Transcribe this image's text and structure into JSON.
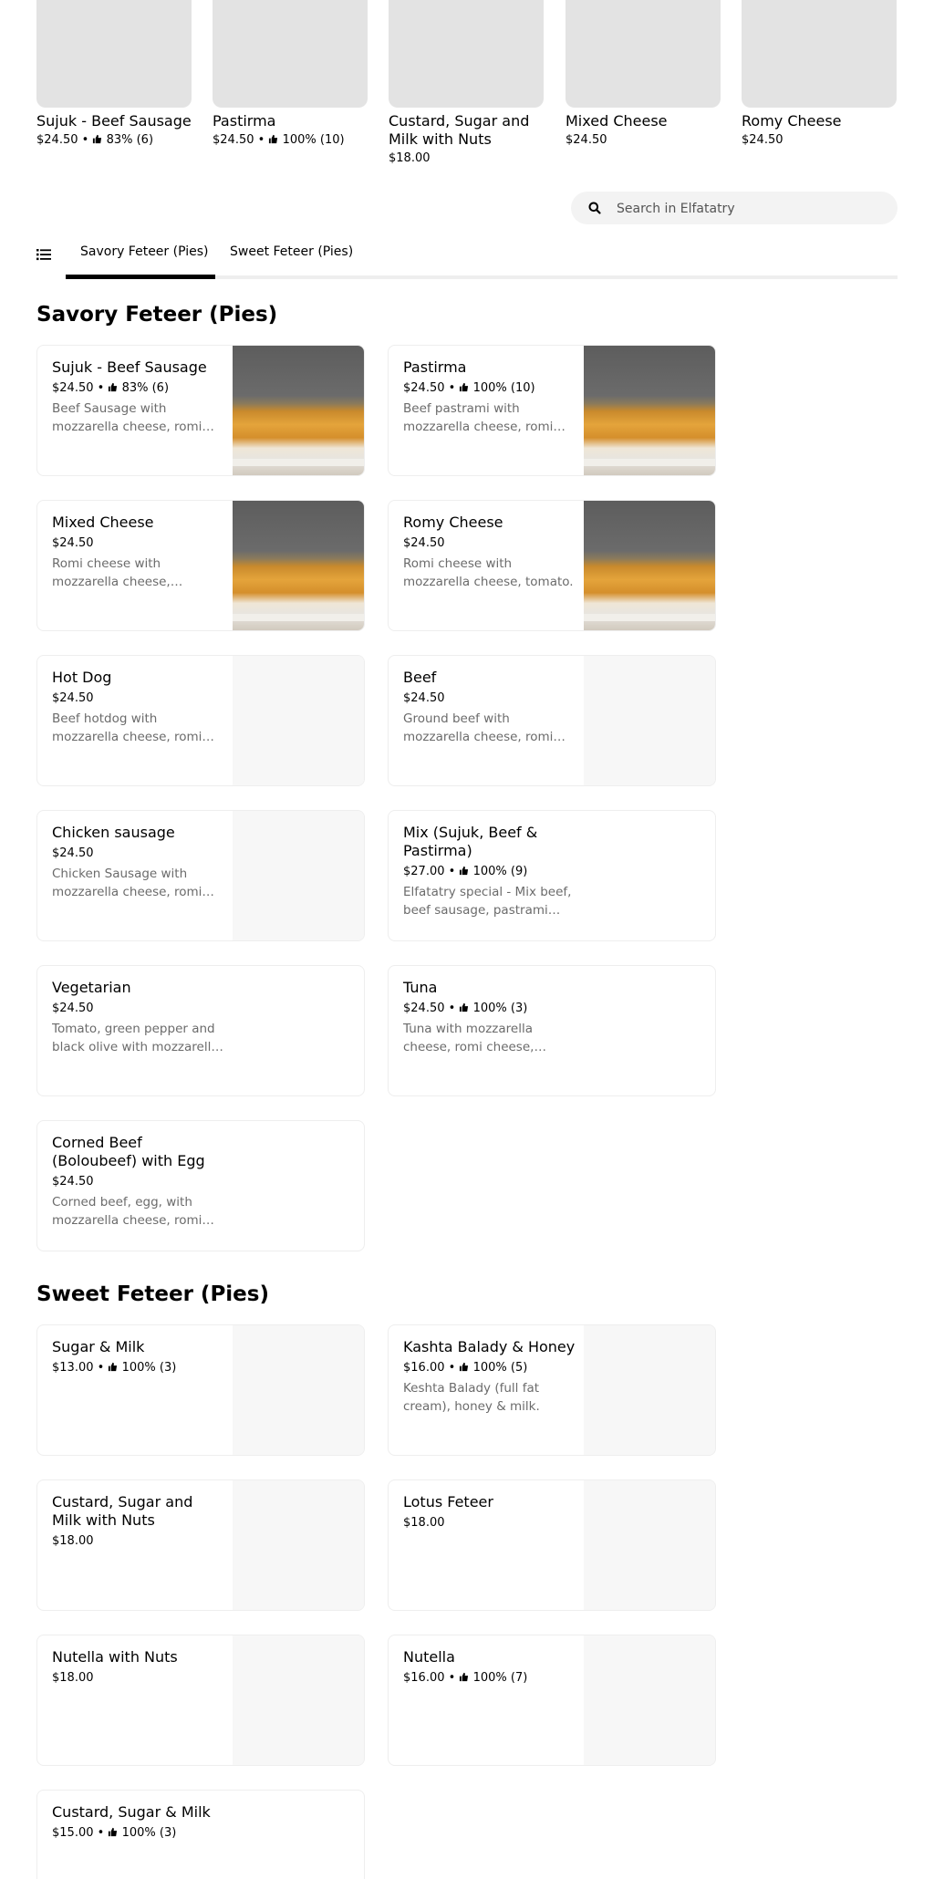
{
  "popular": [
    {
      "name": "Sujuk - Beef Sausage",
      "price": "$24.50",
      "rating": "83% (6)"
    },
    {
      "name": "Pastirma",
      "price": "$24.50",
      "rating": "100% (10)"
    },
    {
      "name": "Custard, Sugar and Milk with Nuts",
      "price": "$18.00",
      "rating": ""
    },
    {
      "name": "Mixed Cheese",
      "price": "$24.50",
      "rating": ""
    },
    {
      "name": "Romy Cheese",
      "price": "$24.50",
      "rating": ""
    }
  ],
  "search": {
    "placeholder": "Search in Elfatatry"
  },
  "tabs": [
    {
      "label": "Savory Feteer (Pies)",
      "active": true
    },
    {
      "label": "Sweet Feteer (Pies)",
      "active": false
    }
  ],
  "sections": [
    {
      "title": "Savory Feteer (Pies)",
      "items": [
        {
          "name": "Sujuk - Beef Sausage",
          "price": "$24.50",
          "rating": "83% (6)",
          "desc": "Beef Sausage with mozzarella cheese, romi cheese, tomato.",
          "photo": true
        },
        {
          "name": "Pastirma",
          "price": "$24.50",
          "rating": "100% (10)",
          "desc": "Beef pastrami with mozzarella cheese, romi cheese, tomato.",
          "photo": true
        },
        {
          "name": "Mixed Cheese",
          "price": "$24.50",
          "rating": "",
          "desc": "Romi cheese with mozzarella cheese, Cheddar cheese.",
          "photo": true
        },
        {
          "name": "Romy Cheese",
          "price": "$24.50",
          "rating": "",
          "desc": "Romi cheese with mozzarella cheese, tomato.",
          "photo": true
        },
        {
          "name": "Hot Dog",
          "price": "$24.50",
          "rating": "",
          "desc": "Beef hotdog with mozzarella cheese, romi cheese, tomato.",
          "photo": false
        },
        {
          "name": "Beef",
          "price": "$24.50",
          "rating": "",
          "desc": "Ground beef with mozzarella cheese, romi cheese, tomato.",
          "photo": false
        },
        {
          "name": "Chicken sausage",
          "price": "$24.50",
          "rating": "",
          "desc": "Chicken Sausage with mozzarella cheese, romi cheese, tomato.",
          "photo": false
        },
        {
          "name": "Mix (Sujuk, Beef & Pastirma)",
          "price": "$27.00",
          "rating": "100% (9)",
          "desc": "Elfatatry special - Mix beef, beef sausage, pastrami with cheese.",
          "photo": false
        },
        {
          "name": "Vegetarian",
          "price": "$24.50",
          "rating": "",
          "desc": "Tomato, green pepper and black olive with mozzarella cheese.",
          "photo": false
        },
        {
          "name": "Tuna",
          "price": "$24.50",
          "rating": "100% (3)",
          "desc": "Tuna with mozzarella cheese, romi cheese, tomato.",
          "photo": false
        },
        {
          "name": "Corned Beef (Boloubeef) with Egg",
          "price": "$24.50",
          "rating": "",
          "desc": "Corned beef, egg, with mozzarella cheese, romi cheese.",
          "photo": false
        }
      ]
    },
    {
      "title": "Sweet Feteer (Pies)",
      "items": [
        {
          "name": "Sugar & Milk",
          "price": "$13.00",
          "rating": "100% (3)",
          "desc": "",
          "photo": false
        },
        {
          "name": "Kashta Balady & Honey",
          "price": "$16.00",
          "rating": "100% (5)",
          "desc": "Keshta Balady (full fat cream), honey & milk.",
          "photo": false
        },
        {
          "name": "Custard, Sugar and Milk with Nuts",
          "price": "$18.00",
          "rating": "",
          "desc": "",
          "photo": false
        },
        {
          "name": "Lotus Feteer",
          "price": "$18.00",
          "rating": "",
          "desc": "",
          "photo": false
        },
        {
          "name": "Nutella with Nuts",
          "price": "$18.00",
          "rating": "",
          "desc": "",
          "photo": false
        },
        {
          "name": "Nutella",
          "price": "$16.00",
          "rating": "100% (7)",
          "desc": "",
          "photo": false
        },
        {
          "name": "Custard, Sugar & Milk",
          "price": "$15.00",
          "rating": "100% (3)",
          "desc": "",
          "photo": false
        }
      ]
    }
  ]
}
